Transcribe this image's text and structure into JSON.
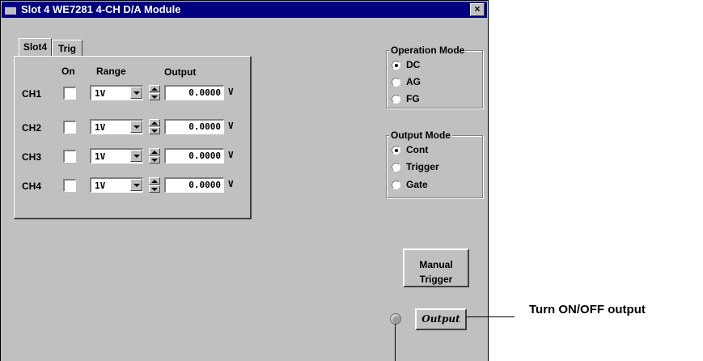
{
  "window": {
    "title": "Slot 4 WE7281 4-CH D/A Module",
    "close_label": "×"
  },
  "tabs": [
    {
      "label": "Slot4"
    },
    {
      "label": "Trig"
    }
  ],
  "table": {
    "headers": {
      "on": "On",
      "range": "Range",
      "output": "Output"
    },
    "channels": [
      {
        "name": "CH1",
        "on": false,
        "range": "1V",
        "output": "0.0000",
        "unit": "V"
      },
      {
        "name": "CH2",
        "on": false,
        "range": "1V",
        "output": "0.0000",
        "unit": "V"
      },
      {
        "name": "CH3",
        "on": false,
        "range": "1V",
        "output": "0.0000",
        "unit": "V"
      },
      {
        "name": "CH4",
        "on": false,
        "range": "1V",
        "output": "0.0000",
        "unit": "V"
      }
    ]
  },
  "operation_mode": {
    "title": "Operation Mode",
    "options": [
      "DC",
      "AG",
      "FG"
    ],
    "selected": "DC"
  },
  "output_mode": {
    "title": "Output Mode",
    "options": [
      "Cont",
      "Trigger",
      "Gate"
    ],
    "selected": "Cont"
  },
  "buttons": {
    "manual_trigger_line1": "Manual",
    "manual_trigger_line2": "Trigger",
    "output": "Output"
  },
  "annotations": {
    "output_callout": "Turn ON/OFF output"
  }
}
